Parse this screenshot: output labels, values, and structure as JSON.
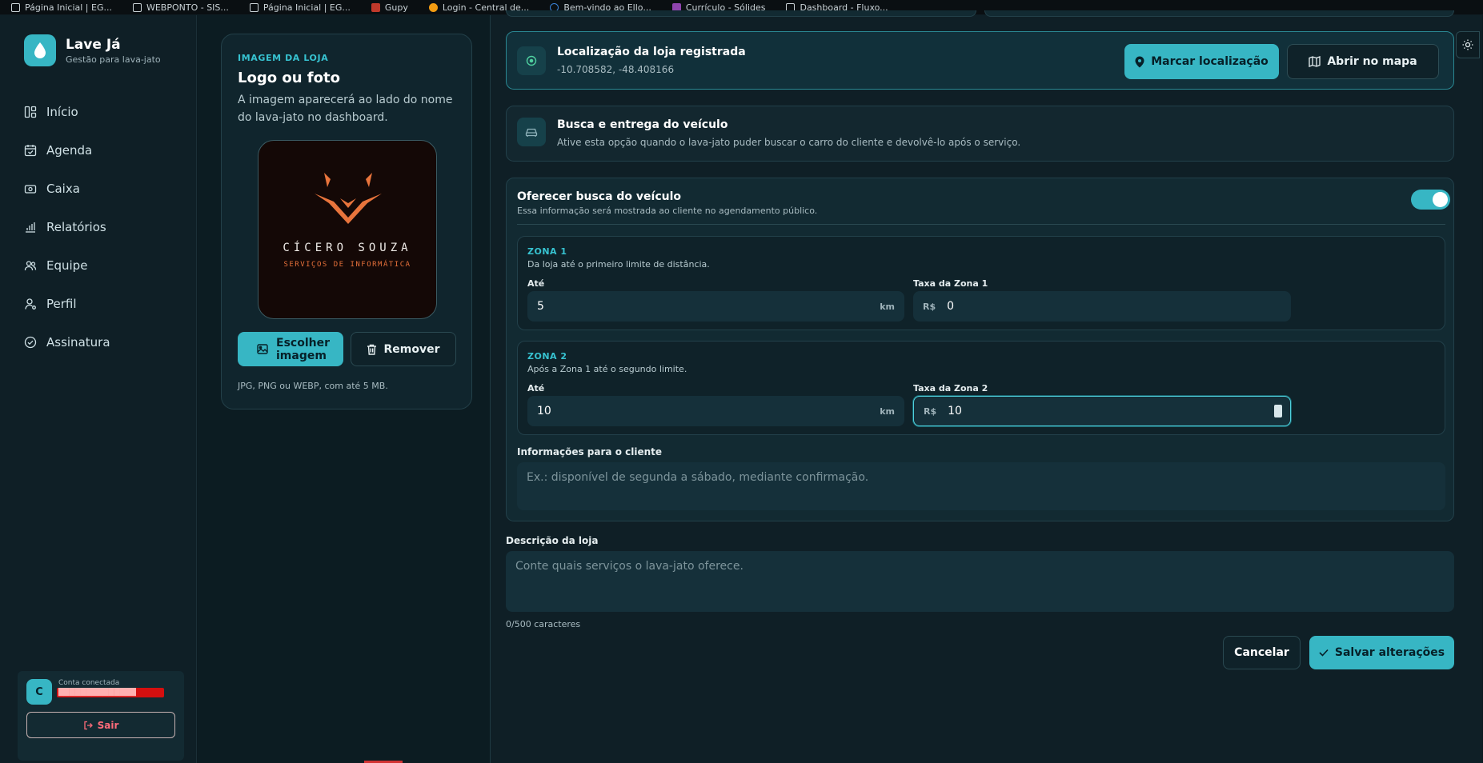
{
  "bookmarks": [
    {
      "label": "Página Inicial | EG...",
      "icon": "page-icon"
    },
    {
      "label": "WEBPONTO - SIS...",
      "icon": "page-icon"
    },
    {
      "label": "Página Inicial | EG...",
      "icon": "page-icon"
    },
    {
      "label": "Gupy",
      "icon": "gupy-icon"
    },
    {
      "label": "Login - Central de...",
      "icon": "login-icon"
    },
    {
      "label": "Bem-vindo ao Ello...",
      "icon": "ello-icon"
    },
    {
      "label": "Currículo - Sólides",
      "icon": "solides-icon"
    },
    {
      "label": "Dashboard - Fluxo...",
      "icon": "page-icon"
    }
  ],
  "sidebar": {
    "brand_title": "Lave Já",
    "brand_subtitle": "Gestão para lava-jato",
    "items": [
      {
        "label": "Início",
        "icon": "dashboard-icon"
      },
      {
        "label": "Agenda",
        "icon": "calendar-icon"
      },
      {
        "label": "Caixa",
        "icon": "cash-icon"
      },
      {
        "label": "Relatórios",
        "icon": "chart-icon"
      },
      {
        "label": "Equipe",
        "icon": "team-icon"
      },
      {
        "label": "Perfil",
        "icon": "profile-icon"
      },
      {
        "label": "Assinatura",
        "icon": "check-circle-icon"
      }
    ],
    "account_label": "Conta conectada",
    "account_initial": "C",
    "account_email": "██████████████",
    "logout_label": "Sair"
  },
  "logo_card": {
    "eyebrow": "IMAGEM DA LOJA",
    "title": "Logo ou foto",
    "description": "A imagem aparecerá ao lado do nome do lava-jato no dashboard.",
    "logo_name": "CÍCERO SOUZA",
    "logo_tagline": "SERVIÇOS DE INFORMÁTICA",
    "choose_label": "Escolher imagem",
    "remove_label": "Remover",
    "note": "JPG, PNG ou WEBP, com até 5 MB."
  },
  "location": {
    "title": "Localização da loja registrada",
    "coords": "-10.708582, -48.408166",
    "mark_label": "Marcar localização",
    "map_label": "Abrir no mapa"
  },
  "pickup": {
    "title": "Busca e entrega do veículo",
    "description": "Ative esta opção quando o lava-jato puder buscar o carro do cliente e devolvê-lo após o serviço."
  },
  "offer": {
    "title": "Oferecer busca do veículo",
    "description": "Essa informação será mostrada ao cliente no agendamento público.",
    "enabled": true,
    "zones": [
      {
        "title": "ZONA 1",
        "description": "Da loja até o primeiro limite de distância.",
        "until_label": "Até",
        "until_value": "5",
        "unit": "km",
        "fee_label": "Taxa da Zona 1",
        "currency": "R$",
        "fee_value": "0"
      },
      {
        "title": "ZONA 2",
        "description": "Após a Zona 1 até o segundo limite.",
        "until_label": "Até",
        "until_value": "10",
        "unit": "km",
        "fee_label": "Taxa da Zona 2",
        "currency": "R$",
        "fee_value": "10"
      }
    ],
    "info_label": "Informações para o cliente",
    "info_placeholder": "Ex.: disponível de segunda a sábado, mediante confirmação."
  },
  "store_description": {
    "label": "Descrição da loja",
    "placeholder": "Conte quais serviços o lava-jato oferece.",
    "count": "0/500 caracteres"
  },
  "actions": {
    "cancel_label": "Cancelar",
    "save_label": "Salvar alterações"
  },
  "colors": {
    "accent": "#37b6c4",
    "background": "#0f1f26",
    "danger": "#ff6b7a"
  }
}
